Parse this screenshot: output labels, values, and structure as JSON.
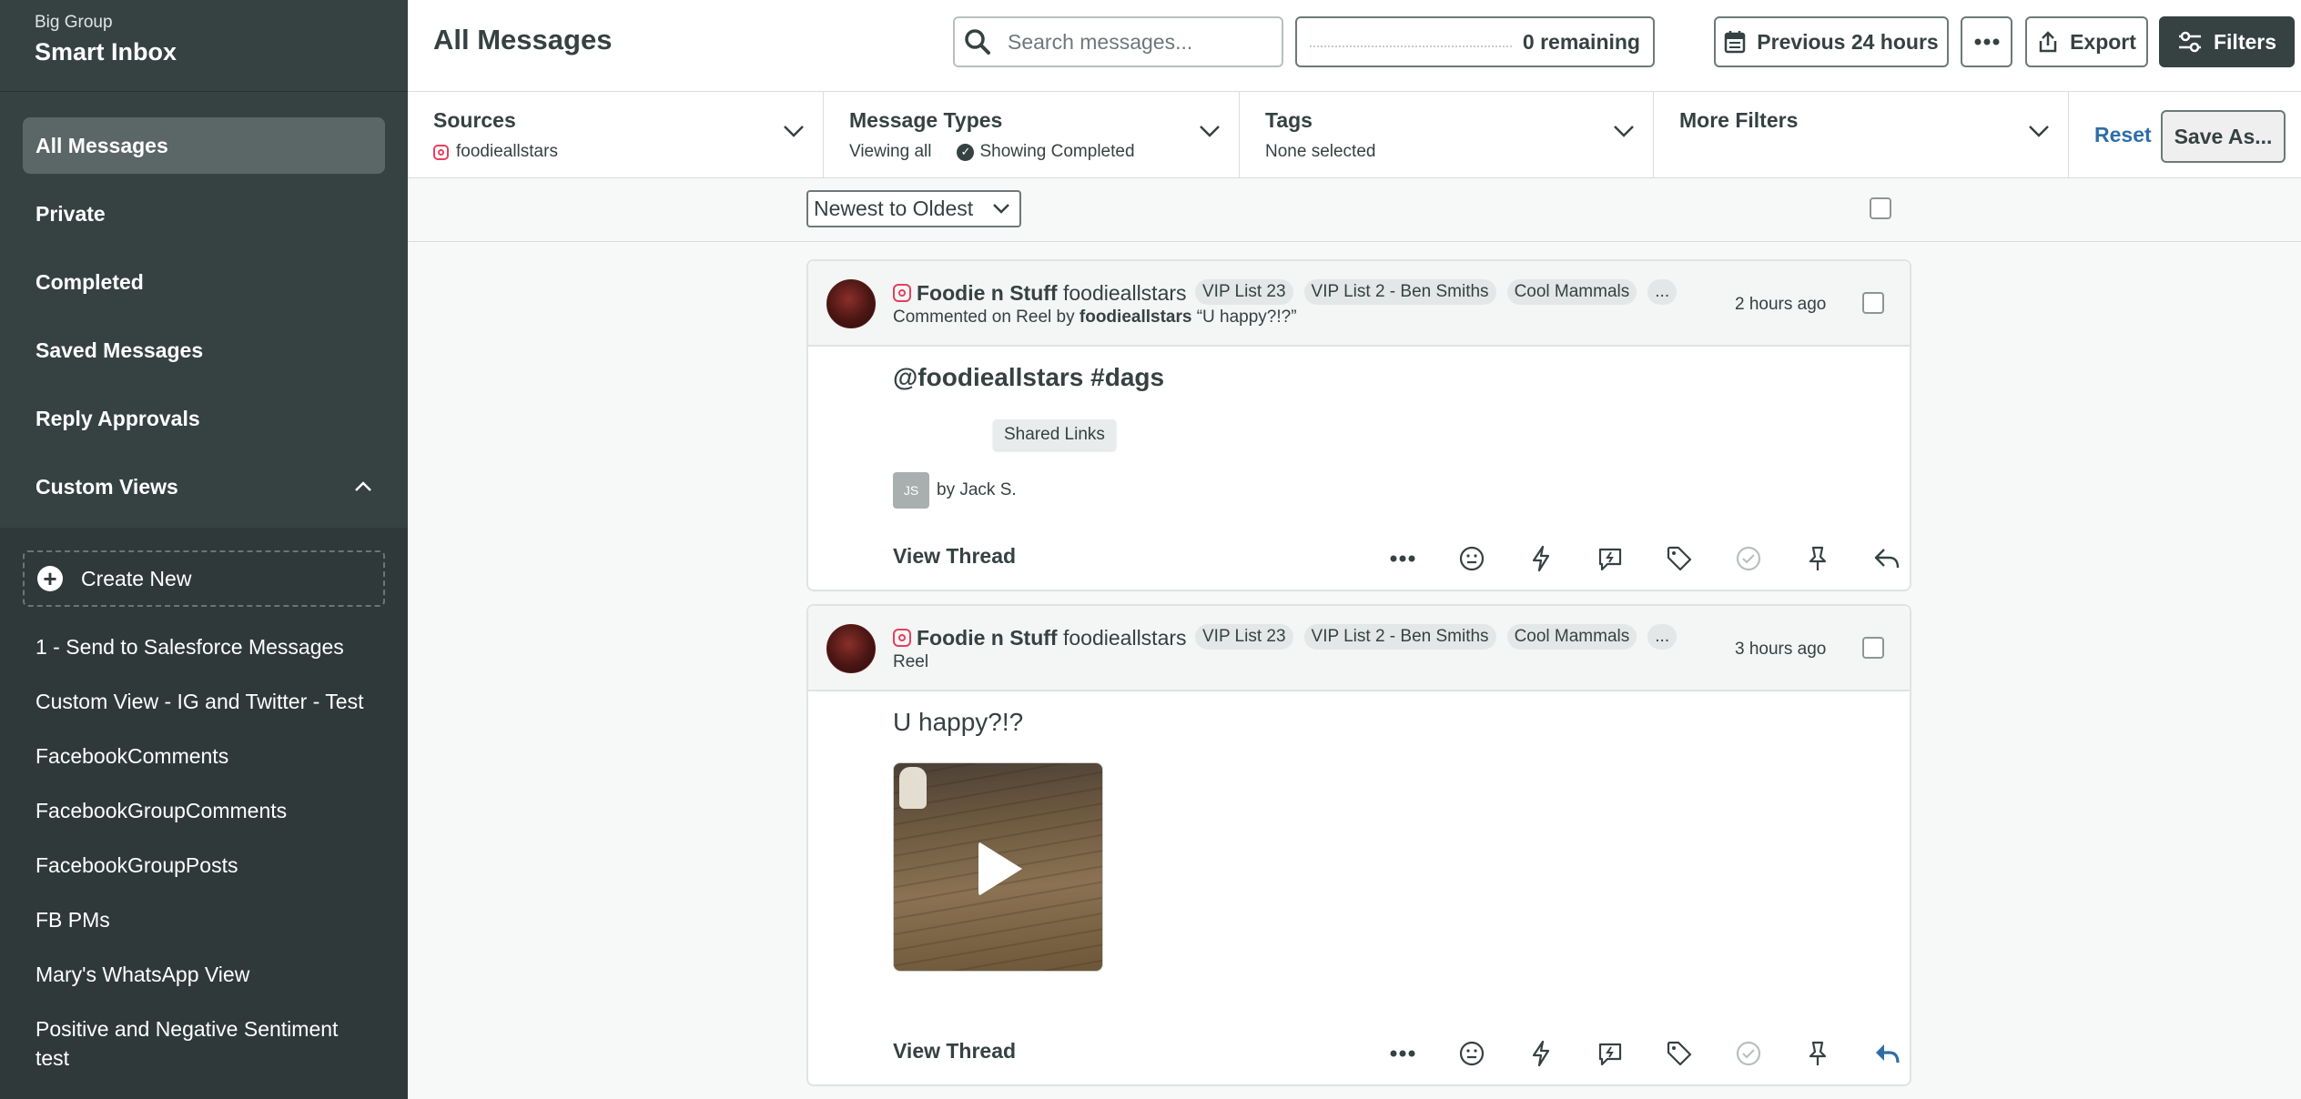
{
  "sidebar": {
    "group": "Big Group",
    "title": "Smart Inbox",
    "nav": [
      {
        "label": "All Messages",
        "active": true
      },
      {
        "label": "Private"
      },
      {
        "label": "Completed"
      },
      {
        "label": "Saved Messages"
      },
      {
        "label": "Reply Approvals"
      }
    ],
    "custom_views_label": "Custom Views",
    "create_new": "Create New",
    "views": [
      "1 - Send to Salesforce Messages",
      "Custom View - IG and Twitter - Test",
      "FacebookComments",
      "FacebookGroupComments",
      "FacebookGroupPosts",
      "FB PMs",
      "Mary's WhatsApp View",
      "Positive and Negative Sentiment test"
    ]
  },
  "header": {
    "title": "All Messages",
    "search_placeholder": "Search messages...",
    "remaining": "0 remaining",
    "date_range": "Previous 24 hours",
    "export": "Export",
    "filters": "Filters"
  },
  "filters": {
    "sources": {
      "title": "Sources",
      "value": "foodieallstars"
    },
    "message_types": {
      "title": "Message Types",
      "value": "Viewing all",
      "status": "Showing Completed"
    },
    "tags": {
      "title": "Tags",
      "value": "None selected"
    },
    "more": {
      "title": "More Filters"
    },
    "reset": "Reset",
    "save_as": "Save As..."
  },
  "sort": {
    "selected": "Newest to Oldest"
  },
  "messages": [
    {
      "name": "Foodie n Stuff",
      "handle": "foodieallstars",
      "tags": [
        "VIP List 23",
        "VIP List 2 - Ben Smiths",
        "Cool Mammals",
        "..."
      ],
      "sub_prefix": "Commented on Reel by ",
      "sub_author": "foodieallstars",
      "sub_quote": " “U happy?!?”",
      "time": "2 hours ago",
      "text": "@foodieallstars #dags",
      "tooltip": "Shared Links",
      "initials": "JS",
      "by": "by Jack S.",
      "view_thread": "View Thread"
    },
    {
      "name": "Foodie n Stuff",
      "handle": "foodieallstars",
      "tags": [
        "VIP List 23",
        "VIP List 2 - Ben Smiths",
        "Cool Mammals",
        "..."
      ],
      "sub": "Reel",
      "time": "3 hours ago",
      "text": "U happy?!?",
      "view_thread": "View Thread"
    }
  ],
  "colors": {
    "sidebar_bg": "#364141",
    "sidebar_lower_bg": "#2f393a",
    "accent_link": "#2e6ea7",
    "instagram": "#e4405f",
    "reply_active": "#2e6ea7"
  },
  "icons": [
    "search-icon",
    "calendar-icon",
    "more-icon",
    "export-icon",
    "filters-icon",
    "chevron-down-icon",
    "chevron-up-icon",
    "plus-icon",
    "instagram-icon",
    "emoji-icon",
    "lightning-icon",
    "message-icon",
    "tag-icon",
    "complete-icon",
    "pin-icon",
    "reply-icon",
    "play-icon"
  ]
}
